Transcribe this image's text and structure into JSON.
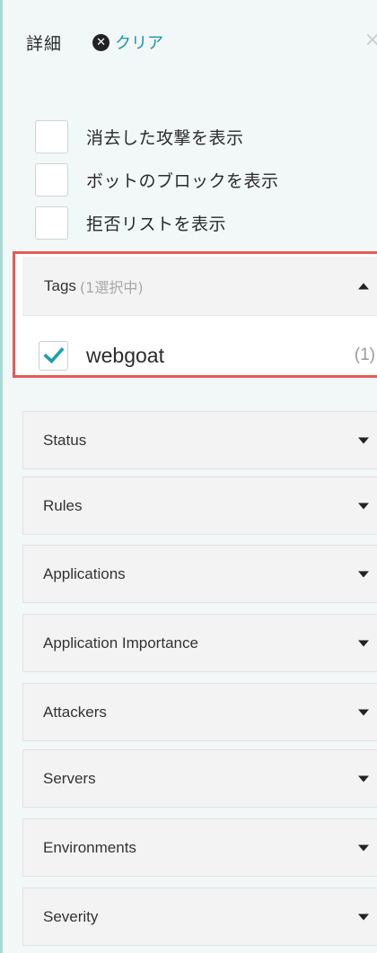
{
  "header": {
    "title": "詳細",
    "clear_label": "クリア",
    "close_glyph": "×"
  },
  "toggles": [
    {
      "label": "消去した攻撃を表示",
      "checked": false
    },
    {
      "label": "ボットのブロックを表示",
      "checked": false
    },
    {
      "label": "拒否リストを表示",
      "checked": false
    }
  ],
  "tags": {
    "title": "Tags",
    "selected_text": "(1選択中)",
    "expanded": true,
    "items": [
      {
        "label": "webgoat",
        "count": "(1)",
        "checked": true
      }
    ]
  },
  "sections": [
    {
      "label": "Status"
    },
    {
      "label": "Rules"
    },
    {
      "label": "Applications"
    },
    {
      "label": "Application Importance"
    },
    {
      "label": "Attackers"
    },
    {
      "label": "Servers"
    },
    {
      "label": "Environments"
    },
    {
      "label": "Severity"
    }
  ],
  "colors": {
    "accent": "#1a97a8",
    "check": "#1a9fb0",
    "highlight_border": "#e8585a",
    "panel_edge": "#a9d8d4"
  }
}
